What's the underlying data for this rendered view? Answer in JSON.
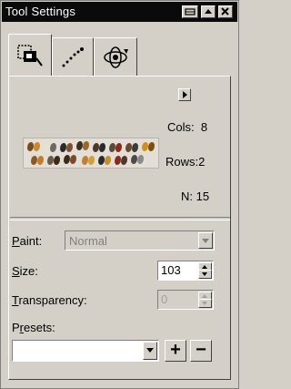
{
  "window": {
    "title": "Tool Settings",
    "buttons": {
      "pin": "pin-icon",
      "collapse": "up-arrow-icon",
      "close": "close-icon"
    }
  },
  "tabs": [
    {
      "name": "image-sprayer-settings",
      "icon": "sprayer-settings-icon",
      "active": true
    },
    {
      "name": "spray-path",
      "icon": "spray-dots-icon",
      "active": false
    },
    {
      "name": "rotation",
      "icon": "rotate-icon",
      "active": false
    }
  ],
  "sprayer": {
    "cols_label": "Cols:",
    "cols_value": "8",
    "rows_label": "Rows:",
    "rows_value": "2",
    "n_label": "N:",
    "n_value": "15"
  },
  "paint": {
    "label_accel": "P",
    "label_rest": "aint:",
    "value": "Normal"
  },
  "size": {
    "label_accel": "S",
    "label_rest": "ize:",
    "value": "103"
  },
  "transparency": {
    "label_accel": "T",
    "label_rest": "ransparency:",
    "value": "0"
  },
  "presets": {
    "label_pre": "P",
    "label_accel": "r",
    "label_rest": "esets:",
    "value": "",
    "add_label": "+",
    "remove_label": "−"
  },
  "colors": {
    "titlebar": "#0a0a0a",
    "face": "#d4d0c8"
  }
}
